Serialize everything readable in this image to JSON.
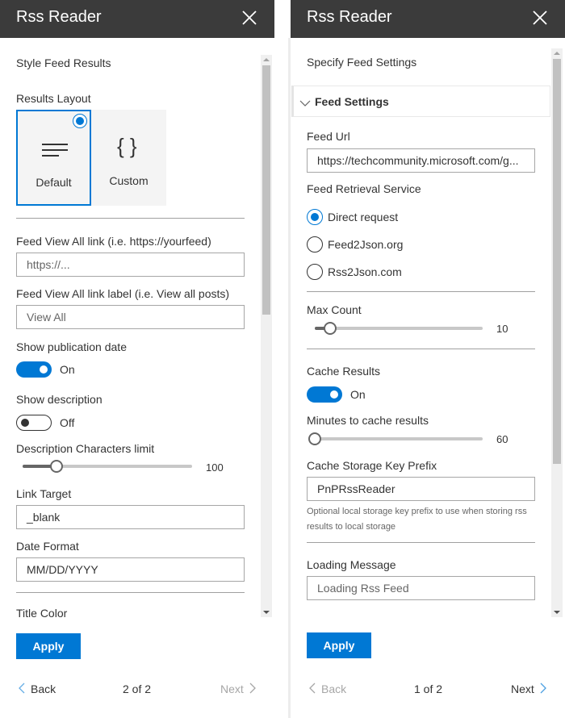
{
  "left_panel": {
    "title": "Rss Reader",
    "page_heading": "Style Feed Results",
    "results_layout": {
      "label": "Results Layout",
      "options": [
        {
          "label": "Default",
          "icon": "text-lines-icon",
          "selected": true
        },
        {
          "label": "Custom",
          "icon": "curly-braces-icon",
          "selected": false
        }
      ]
    },
    "feed_view_all_link": {
      "label": "Feed View All link (i.e. https://yourfeed)",
      "value": "",
      "placeholder": "https://..."
    },
    "feed_view_all_label": {
      "label": "Feed View All link label (i.e. View all posts)",
      "value": "",
      "placeholder": "View All"
    },
    "show_publication_date": {
      "label": "Show publication date",
      "state": true,
      "state_text": "On"
    },
    "show_description": {
      "label": "Show description",
      "state": false,
      "state_text": "Off"
    },
    "description_chars_limit": {
      "label": "Description Characters limit",
      "value": "100",
      "fraction": 0.2
    },
    "link_target": {
      "label": "Link Target",
      "value": "_blank"
    },
    "date_format": {
      "label": "Date Format",
      "value": "MM/DD/YYYY"
    },
    "title_color": {
      "label": "Title Color"
    },
    "apply_label": "Apply",
    "pagination": {
      "back": "Back",
      "indicator": "2 of 2",
      "next": "Next",
      "back_enabled": true,
      "next_enabled": false
    },
    "scroll": {
      "thumb_start": 0.0,
      "thumb_fraction": 0.46
    }
  },
  "right_panel": {
    "title": "Rss Reader",
    "page_heading": "Specify Feed Settings",
    "accordion_title": "Feed Settings",
    "feed_url": {
      "label": "Feed Url",
      "value": "https://techcommunity.microsoft.com/g..."
    },
    "retrieval_service": {
      "label": "Feed Retrieval Service",
      "options": [
        {
          "label": "Direct request",
          "checked": true
        },
        {
          "label": "Feed2Json.org",
          "checked": false
        },
        {
          "label": "Rss2Json.com",
          "checked": false
        }
      ]
    },
    "max_count": {
      "label": "Max Count",
      "value": "10",
      "fraction": 0.09
    },
    "cache_results": {
      "label": "Cache Results",
      "state": true,
      "state_text": "On"
    },
    "minutes_to_cache": {
      "label": "Minutes to cache results",
      "value": "60",
      "fraction": 0.0
    },
    "cache_key_prefix": {
      "label": "Cache Storage Key Prefix",
      "value": "PnPRssReader",
      "hint": "Optional local storage key prefix to use when storing rss results to local storage"
    },
    "loading_message": {
      "label": "Loading Message",
      "value": "",
      "placeholder": "Loading Rss Feed"
    },
    "apply_label": "Apply",
    "pagination": {
      "back": "Back",
      "indicator": "1 of 2",
      "next": "Next",
      "back_enabled": false,
      "next_enabled": true
    },
    "scroll": {
      "thumb_start": 0.0,
      "thumb_fraction": 0.74
    }
  },
  "colors": {
    "accent": "#0078d4",
    "header_bg": "#3b3b3b",
    "text": "#333333",
    "disabled": "#a6a6a6"
  }
}
